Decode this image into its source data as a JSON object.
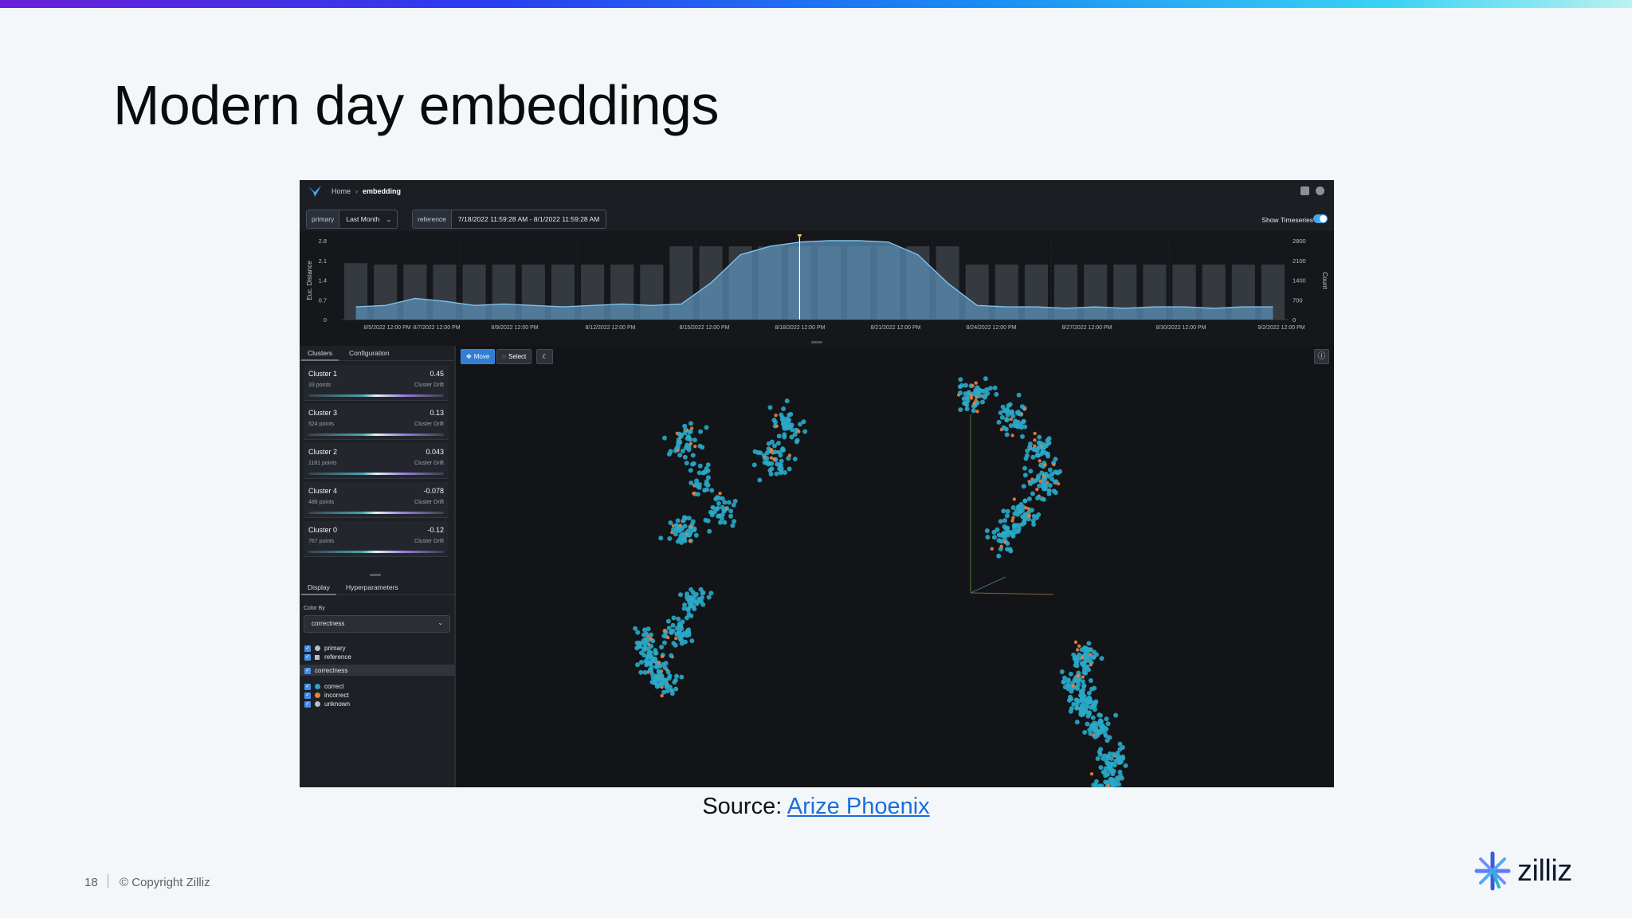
{
  "slide": {
    "title": "Modern day embeddings",
    "source_prefix": "Source:",
    "source_link": "Arize Phoenix",
    "page_number": "18",
    "copyright": "© Copyright Zilliz",
    "brand": "zilliz"
  },
  "app": {
    "breadcrumb": [
      "Home",
      "embedding"
    ],
    "primary_tag": "primary",
    "primary_value": "Last Month",
    "reference_tag": "reference",
    "reference_value": "7/18/2022 11:59:28 AM - 8/1/2022 11:59:28 AM",
    "show_timeseries_label": "Show Timeseries",
    "show_timeseries_on": true
  },
  "chart_data": {
    "type": "bar",
    "ylabel": "Euc. Distance",
    "y2label": "Count",
    "yticks": [
      "2.8",
      "2.1",
      "1.4",
      "0.7",
      "0"
    ],
    "y2ticks": [
      "2800",
      "2100",
      "1400",
      "700",
      "0"
    ],
    "xticks": [
      "8/5/2022 12:00 PM",
      "8/7/2022 12:00 PM",
      "8/9/2022 12:00 PM",
      "8/12/2022 12:00 PM",
      "8/15/2022 12:00 PM",
      "8/18/2022 12:00 PM",
      "8/21/2022 12:00 PM",
      "8/24/2022 12:00 PM",
      "8/27/2022 12:00 PM",
      "8/30/2022 12:00 PM",
      "9/2/2022 12:00 PM"
    ],
    "ylim": [
      0,
      2.8
    ],
    "y2lim": [
      0,
      2800
    ],
    "count_bars": [
      2000,
      1950,
      1950,
      1950,
      1950,
      1950,
      1950,
      1950,
      1950,
      1950,
      1950,
      2600,
      2600,
      2600,
      2600,
      2600,
      2600,
      2600,
      2600,
      2600,
      2600,
      1950,
      1950,
      1950,
      1950,
      1950,
      1950,
      1950,
      1950,
      1950,
      1950,
      1950
    ],
    "distance_line": [
      0.45,
      0.5,
      0.75,
      0.65,
      0.5,
      0.55,
      0.5,
      0.45,
      0.5,
      0.55,
      0.5,
      0.55,
      1.3,
      2.3,
      2.6,
      2.75,
      2.8,
      2.8,
      2.75,
      2.3,
      1.3,
      0.5,
      0.45,
      0.45,
      0.4,
      0.45,
      0.4,
      0.45,
      0.45,
      0.4,
      0.45,
      0.45
    ]
  },
  "panel": {
    "tabs": [
      "Clusters",
      "Configuration"
    ],
    "clusters": [
      {
        "name": "Cluster 1",
        "value": "0.45",
        "points": "33 points",
        "drift": "Cluster Drift"
      },
      {
        "name": "Cluster 3",
        "value": "0.13",
        "points": "524 points",
        "drift": "Cluster Drift"
      },
      {
        "name": "Cluster 2",
        "value": "0.043",
        "points": "1181 points",
        "drift": "Cluster Drift"
      },
      {
        "name": "Cluster 4",
        "value": "-0.078",
        "points": "486 points",
        "drift": "Cluster Drift"
      },
      {
        "name": "Cluster 0",
        "value": "-0.12",
        "points": "767 points",
        "drift": "Cluster Drift"
      }
    ],
    "display_tabs": [
      "Display",
      "Hyperparameters"
    ],
    "color_by_label": "Color By",
    "color_by_value": "correctness",
    "datasets": [
      "primary",
      "reference"
    ],
    "group_label": "correctness",
    "classes": [
      "correct",
      "incorrect",
      "unknown"
    ],
    "colors": {
      "correct": "#2aa8c8",
      "incorrect": "#f07f3c",
      "unknown": "#b8bec6"
    }
  },
  "viewport": {
    "move_label": "Move",
    "select_label": "Select"
  }
}
